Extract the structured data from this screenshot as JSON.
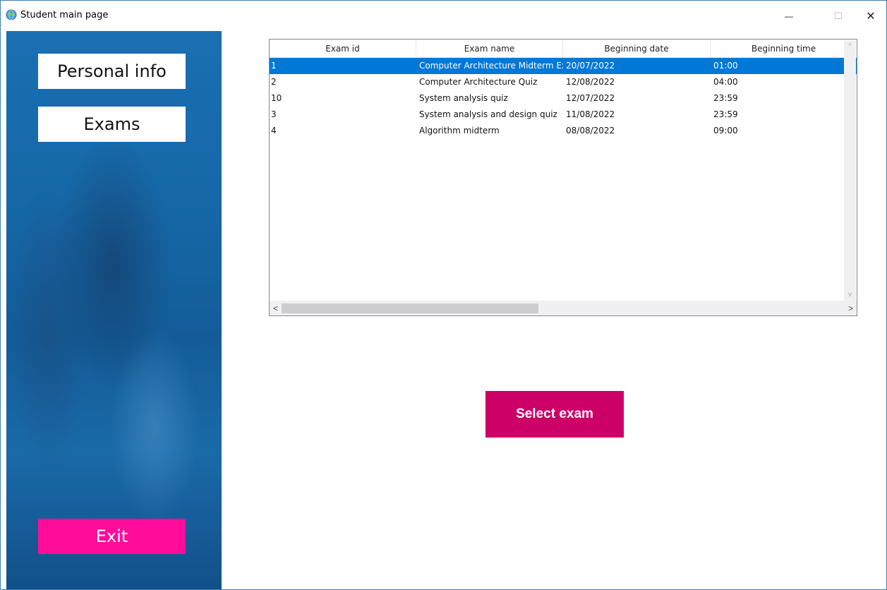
{
  "window": {
    "title": "Student main page",
    "minimize_glyph": "—",
    "maximize_glyph": "☐",
    "close_glyph": "✕"
  },
  "sidebar": {
    "personal_info_label": "Personal info",
    "exams_label": "Exams",
    "exit_label": "Exit"
  },
  "table": {
    "columns": [
      "Exam id",
      "Exam name",
      "Beginning date",
      "Beginning time"
    ],
    "rows": [
      {
        "id": "1",
        "name": "Computer Architecture Midterm Exa",
        "date": "20/07/2022",
        "time": "01:00",
        "selected": true
      },
      {
        "id": "2",
        "name": "Computer Architecture Quiz",
        "date": "12/08/2022",
        "time": "04:00",
        "selected": false
      },
      {
        "id": "10",
        "name": "System analysis quiz",
        "date": "12/07/2022",
        "time": "23:59",
        "selected": false
      },
      {
        "id": "3",
        "name": "System analysis and design quiz",
        "date": "11/08/2022",
        "time": "23:59",
        "selected": false
      },
      {
        "id": "4",
        "name": "Algorithm midterm",
        "date": "08/08/2022",
        "time": "09:00",
        "selected": false
      }
    ],
    "scroll_left_glyph": "<",
    "scroll_right_glyph": ">",
    "scroll_up_glyph": "^",
    "scroll_down_glyph": "v"
  },
  "actions": {
    "select_exam_label": "Select exam"
  },
  "colors": {
    "selection": "#0078d7",
    "select_button": "#cc0066",
    "exit_button": "#ff0c9a",
    "sidebar_blue": "#1668a8"
  },
  "icons": {
    "app": "globe-icon",
    "minimize": "minimize-icon",
    "maximize": "maximize-icon",
    "close": "close-icon"
  }
}
